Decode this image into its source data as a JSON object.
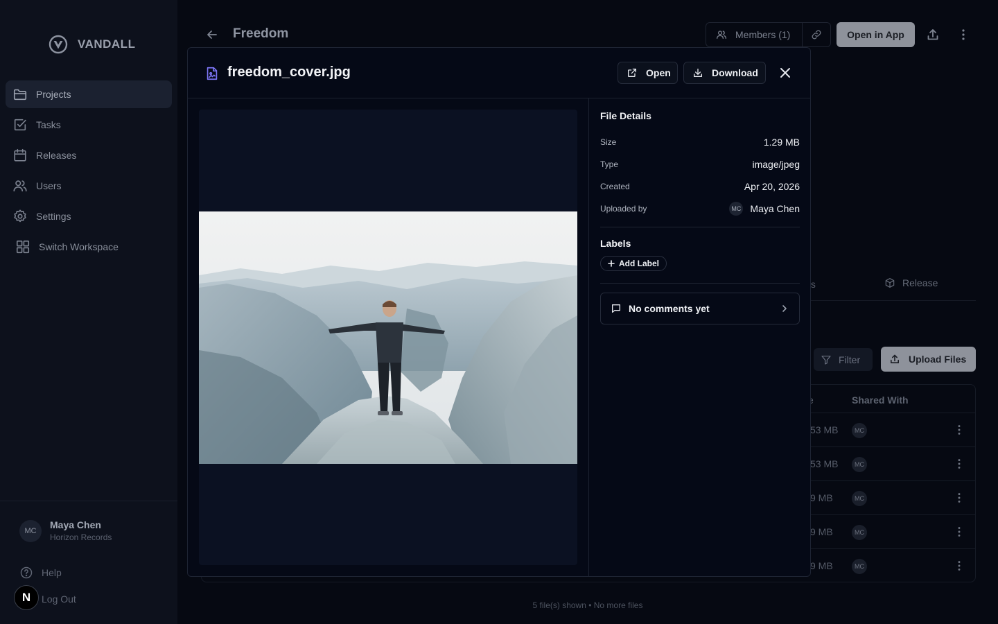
{
  "sidebar": {
    "brand": "VANDALL",
    "nav": [
      {
        "label": "Projects",
        "icon": "folder-icon"
      },
      {
        "label": "Tasks",
        "icon": "checkbox-icon"
      },
      {
        "label": "Releases",
        "icon": "calendar-icon"
      },
      {
        "label": "Users",
        "icon": "users-icon"
      },
      {
        "label": "Settings",
        "icon": "gear-icon"
      },
      {
        "label": "Switch Workspace",
        "icon": "grid-icon"
      }
    ],
    "active": "Projects",
    "user": {
      "initials": "MC",
      "name": "Maya Chen",
      "org": "Horizon Records"
    },
    "help": "Help",
    "logout": "Log Out",
    "badge": "N"
  },
  "header": {
    "title": "Freedom",
    "members": "Members (1)",
    "open_in_app": "Open in App"
  },
  "tabs": {
    "partial": "ts",
    "release": "Release"
  },
  "toolbar": {
    "filter": "Filter",
    "upload": "Upload Files"
  },
  "table": {
    "size_header": "e",
    "shared_header": "Shared With",
    "rows": [
      {
        "size": "53 MB",
        "shared": "MC"
      },
      {
        "size": "53 MB",
        "shared": "MC"
      },
      {
        "size": "9 MB",
        "shared": "MC"
      },
      {
        "size": "9 MB",
        "shared": "MC"
      },
      {
        "size": "9 MB",
        "shared": "MC"
      }
    ]
  },
  "footer": "5 file(s) shown • No more files",
  "modal": {
    "file_name": "freedom_cover.jpg",
    "open": "Open",
    "download": "Download",
    "details_title": "File Details",
    "details": {
      "size_label": "Size",
      "size": "1.29 MB",
      "type_label": "Type",
      "type": "image/jpeg",
      "created_label": "Created",
      "created": "Apr 20, 2026",
      "uploaded_label": "Uploaded by",
      "uploader_initials": "MC",
      "uploader": "Maya Chen"
    },
    "labels_title": "Labels",
    "add_label": "Add Label",
    "comments": "No comments yet"
  },
  "colors": {
    "accent": "#7b74f2",
    "primary_button": "#8e929b",
    "background": "#070a14"
  }
}
